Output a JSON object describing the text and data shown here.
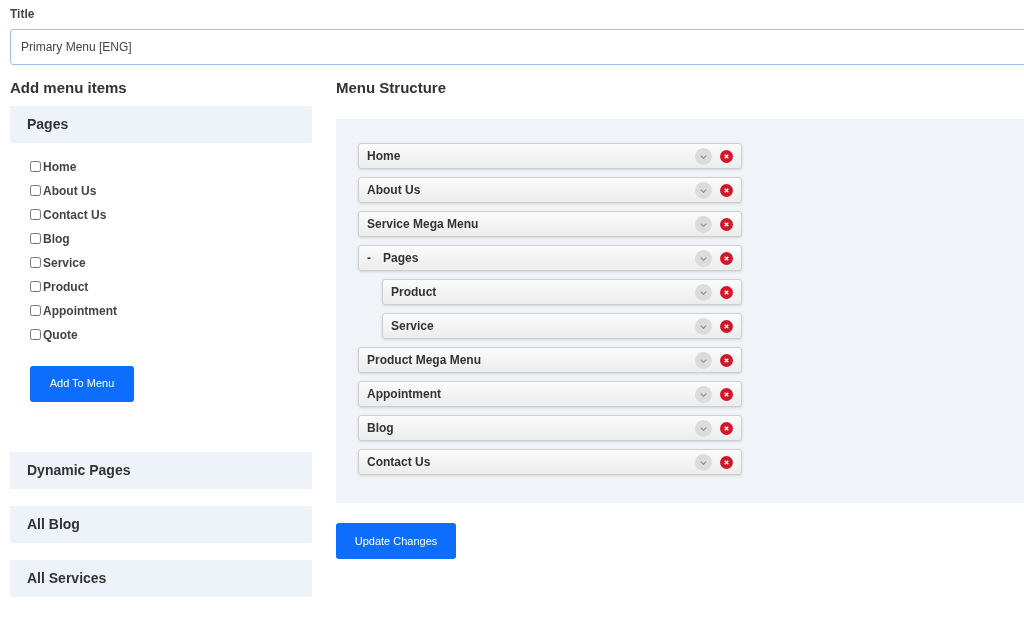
{
  "title_field": {
    "label": "Title",
    "value": "Primary Menu [ENG]"
  },
  "add_menu_items": {
    "heading": "Add menu items",
    "sections": [
      {
        "title": "Pages",
        "items": [
          {
            "label": "Home",
            "checked": false
          },
          {
            "label": "About Us",
            "checked": false
          },
          {
            "label": "Contact Us",
            "checked": false
          },
          {
            "label": "Blog",
            "checked": false
          },
          {
            "label": "Service",
            "checked": false
          },
          {
            "label": "Product",
            "checked": false
          },
          {
            "label": "Appointment",
            "checked": false
          },
          {
            "label": "Quote",
            "checked": false
          }
        ],
        "button": "Add To Menu"
      },
      {
        "title": "Dynamic Pages"
      },
      {
        "title": "All Blog"
      },
      {
        "title": "All Services"
      }
    ]
  },
  "menu_structure": {
    "heading": "Menu Structure",
    "items": [
      {
        "label": "Home"
      },
      {
        "label": "About Us"
      },
      {
        "label": "Service Mega Menu"
      },
      {
        "label": "Pages",
        "toggle": "-",
        "children": [
          {
            "label": "Product"
          },
          {
            "label": "Service"
          }
        ]
      },
      {
        "label": "Product Mega Menu"
      },
      {
        "label": "Appointment"
      },
      {
        "label": "Blog"
      },
      {
        "label": "Contact Us"
      }
    ],
    "button": "Update Changes"
  }
}
